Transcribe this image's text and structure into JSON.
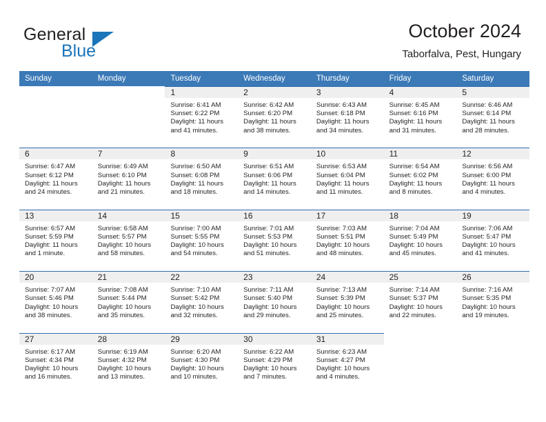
{
  "brand": {
    "word_one": "General",
    "word_two": "Blue",
    "flag_icon": "triangle-flag-icon",
    "accent_color": "#1b75bb"
  },
  "header": {
    "title": "October 2024",
    "location": "Taborfalva, Pest, Hungary"
  },
  "theme": {
    "header_blue": "#3b79b7",
    "rule_blue": "#2b6cad",
    "daynum_band": "#efefef",
    "text": "#231f20"
  },
  "weekdays": [
    "Sunday",
    "Monday",
    "Tuesday",
    "Wednesday",
    "Thursday",
    "Friday",
    "Saturday"
  ],
  "weeks": [
    [
      {
        "day": "",
        "lines": []
      },
      {
        "day": "",
        "lines": []
      },
      {
        "day": "1",
        "lines": [
          "Sunrise: 6:41 AM",
          "Sunset: 6:22 PM",
          "Daylight: 11 hours",
          "and 41 minutes."
        ]
      },
      {
        "day": "2",
        "lines": [
          "Sunrise: 6:42 AM",
          "Sunset: 6:20 PM",
          "Daylight: 11 hours",
          "and 38 minutes."
        ]
      },
      {
        "day": "3",
        "lines": [
          "Sunrise: 6:43 AM",
          "Sunset: 6:18 PM",
          "Daylight: 11 hours",
          "and 34 minutes."
        ]
      },
      {
        "day": "4",
        "lines": [
          "Sunrise: 6:45 AM",
          "Sunset: 6:16 PM",
          "Daylight: 11 hours",
          "and 31 minutes."
        ]
      },
      {
        "day": "5",
        "lines": [
          "Sunrise: 6:46 AM",
          "Sunset: 6:14 PM",
          "Daylight: 11 hours",
          "and 28 minutes."
        ]
      }
    ],
    [
      {
        "day": "6",
        "lines": [
          "Sunrise: 6:47 AM",
          "Sunset: 6:12 PM",
          "Daylight: 11 hours",
          "and 24 minutes."
        ]
      },
      {
        "day": "7",
        "lines": [
          "Sunrise: 6:49 AM",
          "Sunset: 6:10 PM",
          "Daylight: 11 hours",
          "and 21 minutes."
        ]
      },
      {
        "day": "8",
        "lines": [
          "Sunrise: 6:50 AM",
          "Sunset: 6:08 PM",
          "Daylight: 11 hours",
          "and 18 minutes."
        ]
      },
      {
        "day": "9",
        "lines": [
          "Sunrise: 6:51 AM",
          "Sunset: 6:06 PM",
          "Daylight: 11 hours",
          "and 14 minutes."
        ]
      },
      {
        "day": "10",
        "lines": [
          "Sunrise: 6:53 AM",
          "Sunset: 6:04 PM",
          "Daylight: 11 hours",
          "and 11 minutes."
        ]
      },
      {
        "day": "11",
        "lines": [
          "Sunrise: 6:54 AM",
          "Sunset: 6:02 PM",
          "Daylight: 11 hours",
          "and 8 minutes."
        ]
      },
      {
        "day": "12",
        "lines": [
          "Sunrise: 6:56 AM",
          "Sunset: 6:00 PM",
          "Daylight: 11 hours",
          "and 4 minutes."
        ]
      }
    ],
    [
      {
        "day": "13",
        "lines": [
          "Sunrise: 6:57 AM",
          "Sunset: 5:59 PM",
          "Daylight: 11 hours",
          "and 1 minute."
        ]
      },
      {
        "day": "14",
        "lines": [
          "Sunrise: 6:58 AM",
          "Sunset: 5:57 PM",
          "Daylight: 10 hours",
          "and 58 minutes."
        ]
      },
      {
        "day": "15",
        "lines": [
          "Sunrise: 7:00 AM",
          "Sunset: 5:55 PM",
          "Daylight: 10 hours",
          "and 54 minutes."
        ]
      },
      {
        "day": "16",
        "lines": [
          "Sunrise: 7:01 AM",
          "Sunset: 5:53 PM",
          "Daylight: 10 hours",
          "and 51 minutes."
        ]
      },
      {
        "day": "17",
        "lines": [
          "Sunrise: 7:03 AM",
          "Sunset: 5:51 PM",
          "Daylight: 10 hours",
          "and 48 minutes."
        ]
      },
      {
        "day": "18",
        "lines": [
          "Sunrise: 7:04 AM",
          "Sunset: 5:49 PM",
          "Daylight: 10 hours",
          "and 45 minutes."
        ]
      },
      {
        "day": "19",
        "lines": [
          "Sunrise: 7:06 AM",
          "Sunset: 5:47 PM",
          "Daylight: 10 hours",
          "and 41 minutes."
        ]
      }
    ],
    [
      {
        "day": "20",
        "lines": [
          "Sunrise: 7:07 AM",
          "Sunset: 5:46 PM",
          "Daylight: 10 hours",
          "and 38 minutes."
        ]
      },
      {
        "day": "21",
        "lines": [
          "Sunrise: 7:08 AM",
          "Sunset: 5:44 PM",
          "Daylight: 10 hours",
          "and 35 minutes."
        ]
      },
      {
        "day": "22",
        "lines": [
          "Sunrise: 7:10 AM",
          "Sunset: 5:42 PM",
          "Daylight: 10 hours",
          "and 32 minutes."
        ]
      },
      {
        "day": "23",
        "lines": [
          "Sunrise: 7:11 AM",
          "Sunset: 5:40 PM",
          "Daylight: 10 hours",
          "and 29 minutes."
        ]
      },
      {
        "day": "24",
        "lines": [
          "Sunrise: 7:13 AM",
          "Sunset: 5:39 PM",
          "Daylight: 10 hours",
          "and 25 minutes."
        ]
      },
      {
        "day": "25",
        "lines": [
          "Sunrise: 7:14 AM",
          "Sunset: 5:37 PM",
          "Daylight: 10 hours",
          "and 22 minutes."
        ]
      },
      {
        "day": "26",
        "lines": [
          "Sunrise: 7:16 AM",
          "Sunset: 5:35 PM",
          "Daylight: 10 hours",
          "and 19 minutes."
        ]
      }
    ],
    [
      {
        "day": "27",
        "lines": [
          "Sunrise: 6:17 AM",
          "Sunset: 4:34 PM",
          "Daylight: 10 hours",
          "and 16 minutes."
        ]
      },
      {
        "day": "28",
        "lines": [
          "Sunrise: 6:19 AM",
          "Sunset: 4:32 PM",
          "Daylight: 10 hours",
          "and 13 minutes."
        ]
      },
      {
        "day": "29",
        "lines": [
          "Sunrise: 6:20 AM",
          "Sunset: 4:30 PM",
          "Daylight: 10 hours",
          "and 10 minutes."
        ]
      },
      {
        "day": "30",
        "lines": [
          "Sunrise: 6:22 AM",
          "Sunset: 4:29 PM",
          "Daylight: 10 hours",
          "and 7 minutes."
        ]
      },
      {
        "day": "31",
        "lines": [
          "Sunrise: 6:23 AM",
          "Sunset: 4:27 PM",
          "Daylight: 10 hours",
          "and 4 minutes."
        ]
      },
      {
        "day": "",
        "lines": []
      },
      {
        "day": "",
        "lines": []
      }
    ]
  ]
}
